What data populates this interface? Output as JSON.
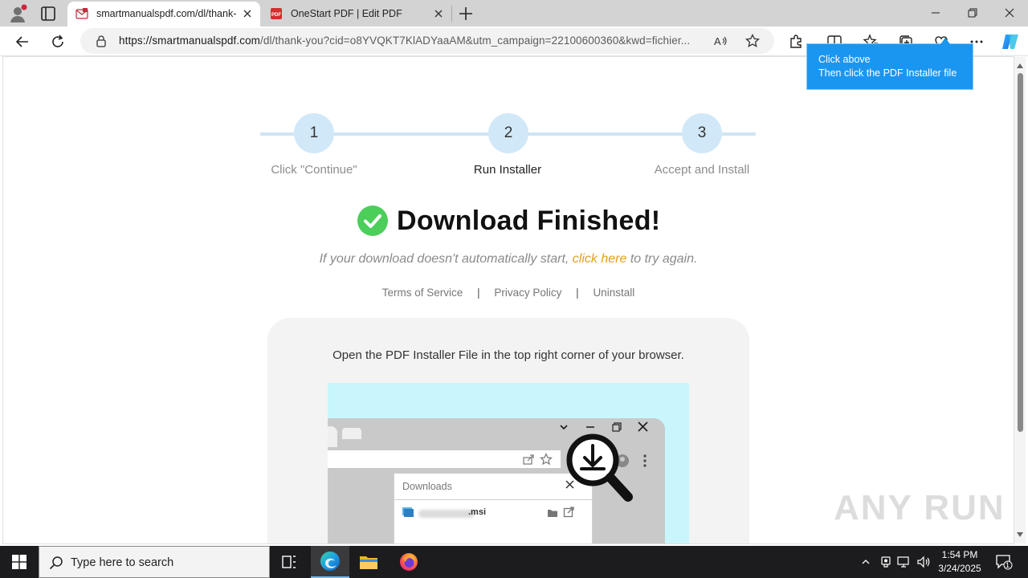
{
  "browser": {
    "tabs": [
      {
        "title": "smartmanualspdf.com/dl/thank-",
        "favicon": "mail-favicon-icon",
        "active": true
      },
      {
        "title": "OneStart PDF | Edit PDF",
        "favicon": "pdf-favicon-icon",
        "active": false
      }
    ],
    "url_host": "https://smartmanualspdf.com",
    "url_path": "/dl/thank-you?cid=o8YVQKT7KlADYaaAM&utm_campaign=22100600360&kwd=fichier...",
    "colors": {
      "tabstrip": "#d3d3d3",
      "accent": "#1a96f0"
    }
  },
  "page": {
    "steps": [
      {
        "number": "1",
        "label": "Click \"Continue\""
      },
      {
        "number": "2",
        "label": "Run Installer"
      },
      {
        "number": "3",
        "label": "Accept and Install"
      }
    ],
    "headline": "Download Finished!",
    "retry": {
      "before": "If your download doesn't automatically start, ",
      "link": "click here",
      "after": " to try again."
    },
    "footer_links": [
      "Terms of Service",
      "Privacy Policy",
      "Uninstall"
    ],
    "footer_separator": "|",
    "card_text": "Open the PDF Installer File in the top right corner of your browser.",
    "illustration": {
      "downloads_title": "Downloads",
      "file_ext": ".msi"
    }
  },
  "tooltip": {
    "line1": "Click above",
    "line2": "Then click the PDF Installer file"
  },
  "watermark": "ANY RUN",
  "taskbar": {
    "search_placeholder": "Type here to search",
    "time": "1:54 PM",
    "date": "3/24/2025",
    "notification_count": "1"
  }
}
